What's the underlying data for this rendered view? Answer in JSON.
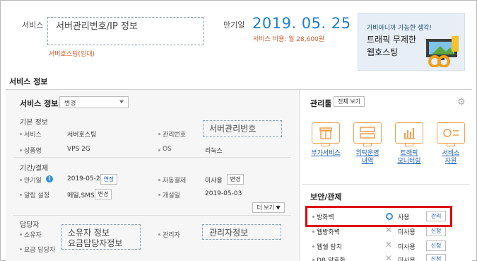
{
  "service": {
    "label": "서비스",
    "placeholder": "서버관리번호/IP 정보",
    "sub": "서버호스팅(임대)"
  },
  "expiry": {
    "label": "만기일",
    "date": "2019. 05. 25",
    "cost": "서비스 비용: 월 28,600원"
  },
  "ad": {
    "line1": "가비아니까 가능한 생각!",
    "line2": "트래픽 무제한",
    "line3": "웹호스팅"
  },
  "section_title": "서비스 정보",
  "left": {
    "title": "서비스 정보",
    "select_value": "변경",
    "basic": {
      "heading": "기본 정보",
      "service_label": "서비스",
      "service_value": "서버호스팅",
      "mgmt_label": "관리번호",
      "mgmt_placeholder": "서버관리번호",
      "product_label": "상품명",
      "product_value": "VPS 2G",
      "os_label": "OS",
      "os_value": "리눅스"
    },
    "period": {
      "heading": "기간/결제",
      "expiry_label": "만기일",
      "expiry_value": "2019-05-25",
      "extend_btn": "연장",
      "autopay_label": "자동결제",
      "autopay_value": "미사용",
      "autopay_btn": "변경",
      "alert_label": "알림 설정",
      "alert_value": "메일,SMS",
      "alert_btn": "변경",
      "open_label": "개설일",
      "open_value": "2019-05-03",
      "more_btn": "더 보기 ▼"
    },
    "contact": {
      "heading": "담당자",
      "owner_label": "소유자",
      "billing_label": "요금 담당자",
      "owner_placeholder_1": "소유자 정보",
      "owner_placeholder_2": "요금담당자정보",
      "admin_label": "관리자",
      "admin_placeholder": "관리자정보"
    }
  },
  "right": {
    "tools_title": "관리툴",
    "tools_btn": "전체 보기",
    "tools": [
      {
        "label": "부가서비스",
        "icon": "gift-icon"
      },
      {
        "label": "위탁운영\n내역",
        "icon": "server-icon"
      },
      {
        "label": "트래픽\n모니터링",
        "icon": "chart-icon"
      },
      {
        "label": "서비스\n자원",
        "icon": "resource-icon"
      }
    ],
    "security_title": "보안/관제",
    "security_rows": [
      {
        "label": "방화벽",
        "status": "사용",
        "btn": "관리"
      },
      {
        "label": "웹방화벽",
        "status": "미사용",
        "btn": "신청"
      },
      {
        "label": "웹쉘 탐지",
        "status": "미사용",
        "btn": "신청"
      },
      {
        "label": "DB 암호화",
        "status": "미사용",
        "btn": "신청"
      }
    ]
  },
  "colors": {
    "accent_blue": "#1a7fd0",
    "orange": "#e05a2b",
    "highlight_red": "#e00000",
    "icon_orange": "#f29f4b"
  }
}
